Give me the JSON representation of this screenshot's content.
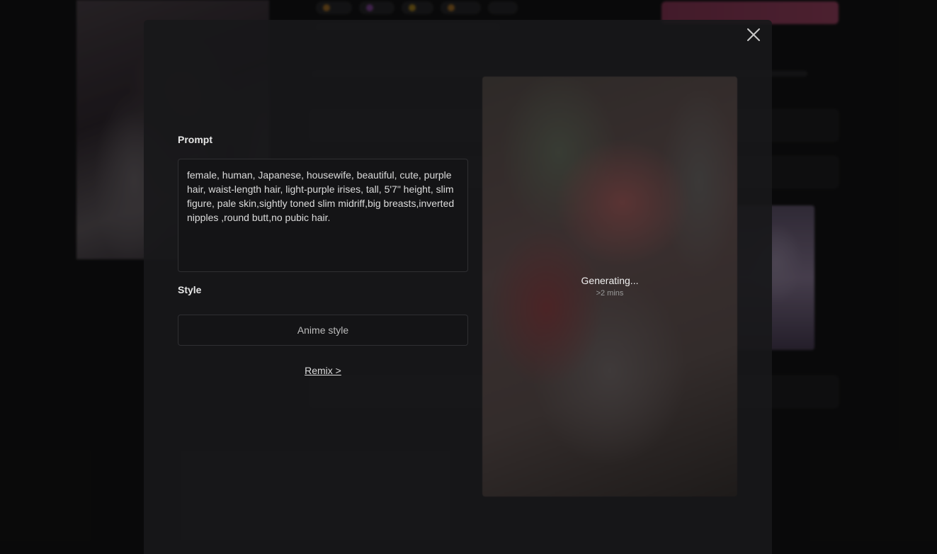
{
  "modal": {
    "prompt_label": "Prompt",
    "prompt_value": "female, human, Japanese, housewife, beautiful, cute, purple hair, waist-length hair, light-purple irises, tall, 5'7\" height, slim figure, pale skin,sightly toned slim midriff,big breasts,inverted nipples ,round butt,no pubic hair.",
    "style_label": "Style",
    "style_value": "Anime style",
    "remix_label": "Remix >",
    "status_text": "Generating...",
    "status_eta": ">2 mins",
    "close_icon": "close-icon"
  },
  "colors": {
    "modal_bg": "#18181a",
    "accent_pink": "#c8507a"
  }
}
